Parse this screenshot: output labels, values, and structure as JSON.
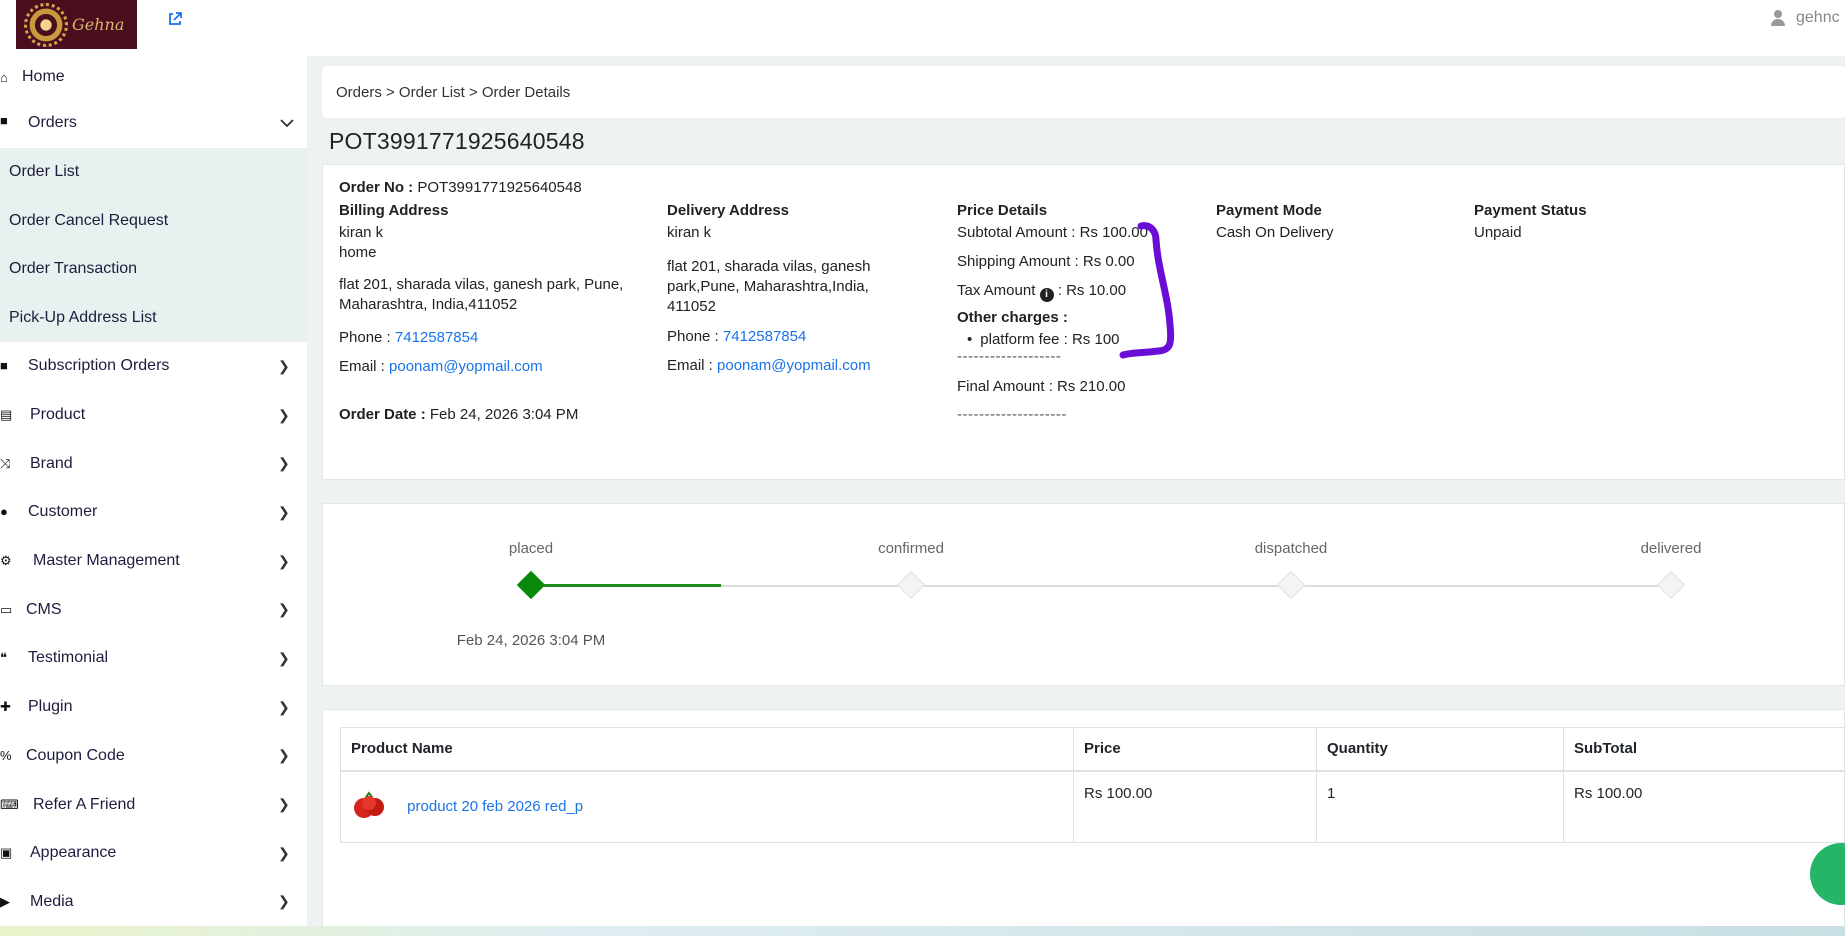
{
  "header": {
    "logo_text": "Gehna",
    "logo_subtext": "JEWELERS",
    "external_link_icon": "external-link-icon",
    "username": "gehnc"
  },
  "sidebar": {
    "items": [
      {
        "label": "Home",
        "icon": "home-icon"
      },
      {
        "label": "Orders",
        "icon": "bag-icon",
        "expanded": true
      },
      {
        "label": "Subscription Orders",
        "icon": "bag-icon"
      },
      {
        "label": "Product",
        "icon": "archive-icon"
      },
      {
        "label": "Brand",
        "icon": "shuffle-icon"
      },
      {
        "label": "Customer",
        "icon": "user-icon"
      },
      {
        "label": "Master Management",
        "icon": "user-gear-icon"
      },
      {
        "label": "CMS",
        "icon": "cms-icon"
      },
      {
        "label": "Testimonial",
        "icon": "quote-icon"
      },
      {
        "label": "Plugin",
        "icon": "puzzle-icon"
      },
      {
        "label": "Coupon Code",
        "icon": "percent-icon"
      },
      {
        "label": "Refer A Friend",
        "icon": "keyboard-icon"
      },
      {
        "label": "Appearance",
        "icon": "image-icon"
      },
      {
        "label": "Media",
        "icon": "play-icon"
      }
    ],
    "orders_submenu": [
      "Order List",
      "Order Cancel Request",
      "Order Transaction",
      "Pick-Up Address List"
    ]
  },
  "breadcrumb": {
    "text": "Orders > Order List > Order Details"
  },
  "order": {
    "title": "POT3991771925640548",
    "order_no_label": "Order No :",
    "order_no": "POT3991771925640548",
    "billing": {
      "heading": "Billing Address",
      "name": "kiran k",
      "type": "home",
      "address": "flat 201, sharada vilas, ganesh park, Pune, Maharashtra, India,411052",
      "phone_label": "Phone :",
      "phone": "7412587854",
      "email_label": "Email :",
      "email": "poonam@yopmail.com"
    },
    "order_date_label": "Order Date :",
    "order_date": "Feb 24, 2026 3:04 PM",
    "delivery": {
      "heading": "Delivery Address",
      "name": "kiran k",
      "address": "flat 201, sharada vilas, ganesh park,Pune, Maharashtra,India, 411052",
      "phone_label": "Phone :",
      "phone": "7412587854",
      "email_label": "Email :",
      "email": "poonam@yopmail.com"
    },
    "price": {
      "heading": "Price Details",
      "subtotal": "Subtotal Amount : Rs 100.00",
      "shipping": "Shipping Amount : Rs 0.00",
      "tax_label": "Tax Amount",
      "tax_value": ": Rs  10.00",
      "other_label": "Other charges :",
      "platform_fee": "platform fee :  Rs  100",
      "divider1": "-------------------",
      "final": "Final Amount : Rs  210.00",
      "divider2": "--------------------"
    },
    "payment_mode": {
      "heading": "Payment Mode",
      "value": "Cash On Delivery"
    },
    "payment_status": {
      "heading": "Payment Status",
      "value": "Unpaid"
    }
  },
  "timeline": {
    "steps": [
      "placed",
      "confirmed",
      "dispatched",
      "delivered"
    ],
    "completed_steps": 1,
    "placed_date": "Feb 24, 2026 3:04 PM"
  },
  "items_table": {
    "headers": [
      "Product Name",
      "Price",
      "Quantity",
      "SubTotal"
    ],
    "rows": [
      {
        "name": "product 20 feb 2026 red_p",
        "price": "Rs 100.00",
        "quantity": "1",
        "subtotal": "Rs 100.00"
      }
    ]
  },
  "colors": {
    "accent": "#1a73e8",
    "success": "#0a8a0a",
    "annotation": "#6a0dd6",
    "logo_bg": "#4a0f1e"
  }
}
